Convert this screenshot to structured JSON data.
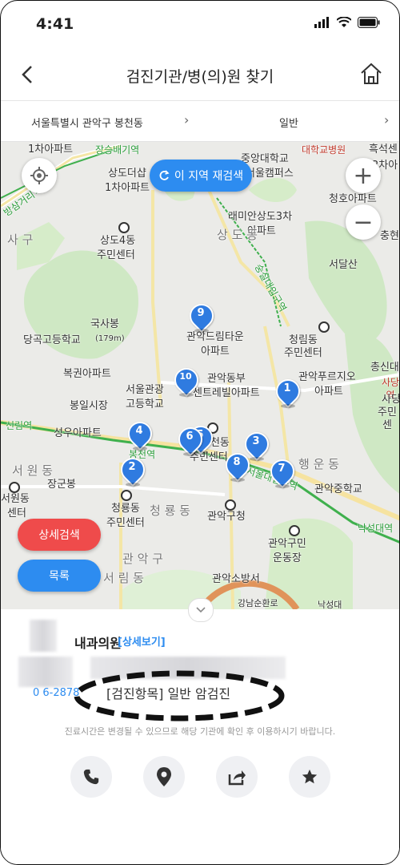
{
  "status_bar": {
    "time": "4:41"
  },
  "header": {
    "title": "검진기관/병(의)원 찾기"
  },
  "filter": {
    "location": "서울특별시 관악구 봉천동",
    "type": "일반"
  },
  "map": {
    "research_label": "이 지역 재검색",
    "zoom_in": "+",
    "zoom_out": "−",
    "detail_search_label": "상세검색",
    "list_label": "목록",
    "labels": {
      "l1": "1차아파트",
      "l2": "장승배기역",
      "l3": "상도더샵",
      "l4": "1차아파트",
      "l5": "중앙대학교",
      "l6": "서울캠퍼스",
      "l7": "대학교병원",
      "l8": "흑석센",
      "l9": "2차아",
      "l10": "청호아파트",
      "l11": "방삼거리역",
      "l12": "래미안상도3차",
      "l13": "아파트",
      "l14": "충현",
      "l15": "사 구",
      "l16": "상 도 동",
      "l17": "상도4동",
      "l18": "주민센터",
      "l19": "서달산",
      "l20": "숭실대입구역",
      "l21": "국사봉",
      "l22": "(179m)",
      "l23": "당곡고등학교",
      "l24": "관악드림타운",
      "l25": "아파트",
      "l26": "청림동",
      "l27": "주민센터",
      "l28": "총신대",
      "l29": "사당역",
      "l30": "복권아파트",
      "l31": "서울관광",
      "l32": "고등학교",
      "l33": "관악동부",
      "l34": "센트레빌아파트",
      "l35": "관악푸르지오",
      "l36": "아파트",
      "l37": "봉일시장",
      "l38": "신림역",
      "l39": "성우아파트",
      "l40": "봉천역",
      "l41": "봉천동",
      "l42": "주민센터",
      "l43": "행 운 동",
      "l44": "사당",
      "l45": "주민센",
      "l46": "서 원 동",
      "l47": "장군봉",
      "l48": "서울대입구역",
      "l49": "관악중학교",
      "l50": "서원동",
      "l51": "센터",
      "l52": "청룡동",
      "l53": "주민센터",
      "l54": "청 룡 동",
      "l55": "관악구청",
      "l56": "낙성대역",
      "l57": "관 악 구",
      "l58": "관악구민",
      "l59": "운동장",
      "l60": "서 림 동",
      "l61": "관악소방서",
      "l62": "강남순환로",
      "l63": "낙성대"
    },
    "markers": [
      "1",
      "2",
      "3",
      "4",
      "5",
      "6",
      "7",
      "8",
      "9",
      "10"
    ]
  },
  "result": {
    "clinic_name_suffix": "내과의원",
    "detail_link": "[상세보기]",
    "phone_partial": "0     6-2878",
    "check_items": "[검진항목] 일반 암검진",
    "notice": "진료시간은 변경될 수 있으므로 해당 기관에 확인 후 이용하시기 바랍니다."
  },
  "colors": {
    "accent": "#2d8cf0",
    "danger": "#ef4b4b",
    "marker": "#2f7be0"
  },
  "icons": [
    "back-icon",
    "home-icon",
    "chevron-right-icon",
    "location-target-icon",
    "refresh-icon",
    "zoom-in-icon",
    "zoom-out-icon",
    "chevron-down-icon",
    "phone-icon",
    "map-pin-icon",
    "share-icon",
    "star-icon"
  ]
}
